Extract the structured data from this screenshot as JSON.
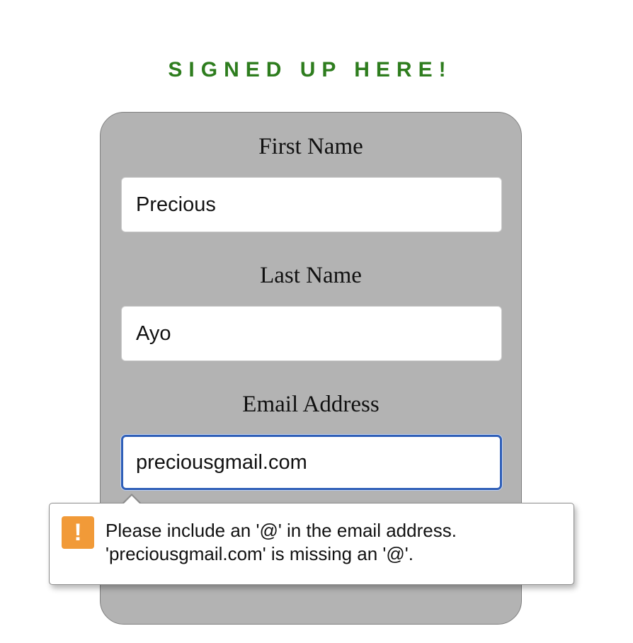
{
  "page": {
    "title": "SIGNED UP HERE!"
  },
  "form": {
    "fields": [
      {
        "label": "First Name",
        "value": "Precious"
      },
      {
        "label": "Last Name",
        "value": "Ayo"
      },
      {
        "label": "Email Address",
        "value": "preciousgmail.com"
      }
    ]
  },
  "validation": {
    "icon": "warning-icon",
    "icon_glyph": "!",
    "line1": "Please include an '@' in the email address.",
    "line2": "'preciousgmail.com' is missing an '@'."
  },
  "colors": {
    "title": "#2e7d1e",
    "card_background": "#b3b3b3",
    "focus_border": "#2f5fb8",
    "warning": "#f19a38"
  }
}
